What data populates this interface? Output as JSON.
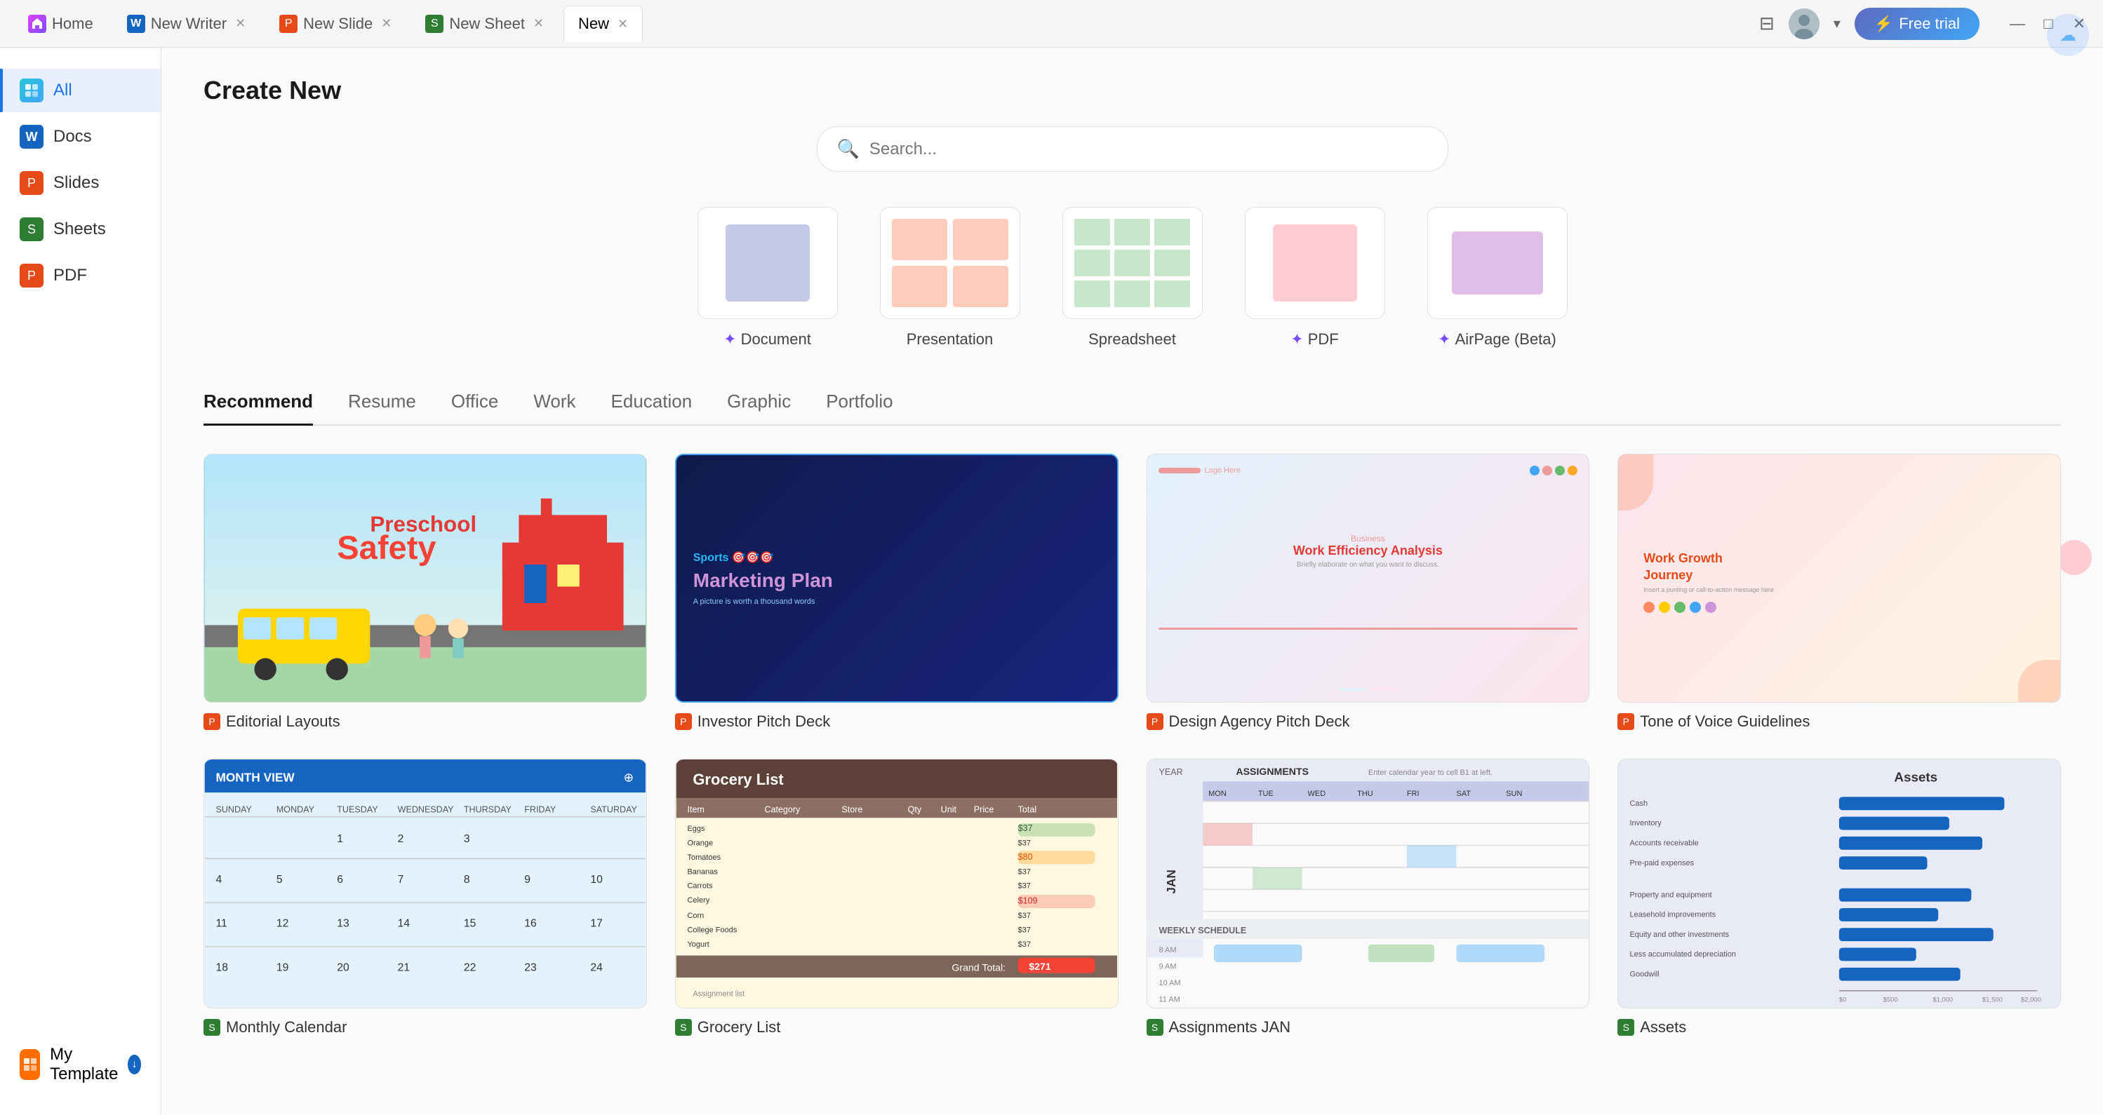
{
  "titlebar": {
    "tabs": [
      {
        "id": "home",
        "label": "Home",
        "icon": "W",
        "type": "home",
        "active": false,
        "closable": false
      },
      {
        "id": "writer",
        "label": "New Writer",
        "icon": "W",
        "type": "writer",
        "active": false,
        "closable": true
      },
      {
        "id": "slide",
        "label": "New Slide",
        "icon": "P",
        "type": "slide",
        "active": false,
        "closable": true
      },
      {
        "id": "sheet",
        "label": "New Sheet",
        "icon": "S",
        "type": "sheet",
        "active": false,
        "closable": true
      },
      {
        "id": "new",
        "label": "New",
        "icon": "",
        "type": "new",
        "active": true,
        "closable": true
      }
    ],
    "free_trial": "Free trial",
    "win_controls": [
      "—",
      "□",
      "✕"
    ]
  },
  "sidebar": {
    "items": [
      {
        "id": "all",
        "label": "All",
        "icon": "◈",
        "active": true
      },
      {
        "id": "docs",
        "label": "Docs",
        "icon": "W",
        "active": false
      },
      {
        "id": "slides",
        "label": "Slides",
        "icon": "P",
        "active": false
      },
      {
        "id": "sheets",
        "label": "Sheets",
        "icon": "S",
        "active": false
      },
      {
        "id": "pdf",
        "label": "PDF",
        "icon": "P",
        "active": false
      }
    ],
    "my_template": "My Template"
  },
  "page": {
    "title": "Create New",
    "search_placeholder": "Search..."
  },
  "type_cards": [
    {
      "id": "document",
      "label": "Document",
      "ai": true
    },
    {
      "id": "presentation",
      "label": "Presentation",
      "ai": false
    },
    {
      "id": "spreadsheet",
      "label": "Spreadsheet",
      "ai": false
    },
    {
      "id": "pdf",
      "label": "PDF",
      "ai": true
    },
    {
      "id": "airpage",
      "label": "AirPage (Beta)",
      "ai": true
    }
  ],
  "categories": [
    {
      "id": "recommend",
      "label": "Recommend",
      "active": true
    },
    {
      "id": "resume",
      "label": "Resume",
      "active": false
    },
    {
      "id": "office",
      "label": "Office",
      "active": false
    },
    {
      "id": "work",
      "label": "Work",
      "active": false
    },
    {
      "id": "education",
      "label": "Education",
      "active": false
    },
    {
      "id": "graphic",
      "label": "Graphic",
      "active": false
    },
    {
      "id": "portfolio",
      "label": "Portfolio",
      "active": false
    }
  ],
  "templates": [
    {
      "id": "preschool",
      "name": "Editorial Layouts",
      "type": "slide",
      "thumb": "preschool"
    },
    {
      "id": "investor",
      "name": "Investor Pitch Deck",
      "type": "slide",
      "thumb": "investor"
    },
    {
      "id": "design",
      "name": "Design Agency Pitch Deck",
      "type": "slide",
      "thumb": "design"
    },
    {
      "id": "tone",
      "name": "Tone of Voice Guidelines",
      "type": "slide",
      "thumb": "tone"
    },
    {
      "id": "monthly",
      "name": "Monthly Calendar",
      "type": "sheet",
      "thumb": "monthly"
    },
    {
      "id": "grocery",
      "name": "Grocery List",
      "type": "sheet",
      "thumb": "grocery"
    },
    {
      "id": "assignments",
      "name": "Assignments JAN",
      "type": "sheet",
      "thumb": "assignments"
    },
    {
      "id": "assets",
      "name": "Assets",
      "type": "sheet",
      "thumb": "assets"
    }
  ]
}
